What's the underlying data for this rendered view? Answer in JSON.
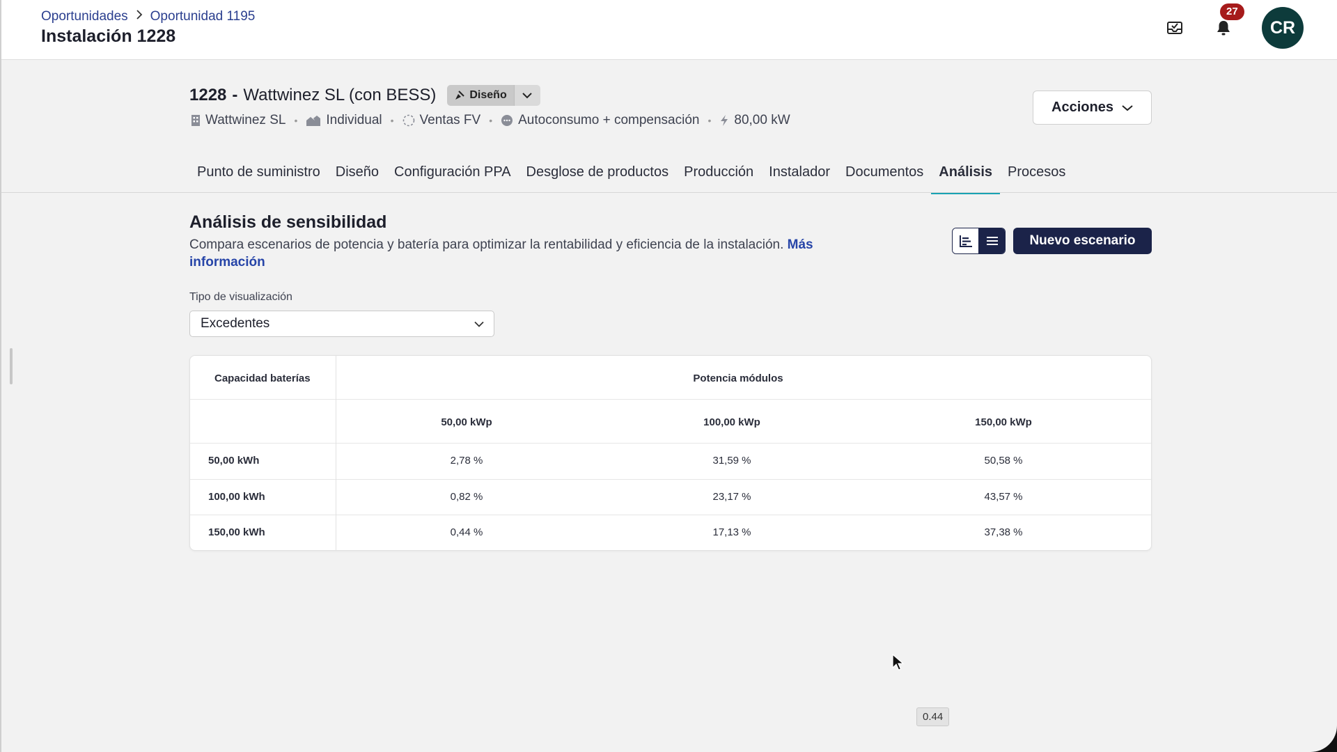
{
  "breadcrumb": {
    "items": [
      "Oportunidades",
      "Oportunidad 1195"
    ],
    "title": "Instalación 1228"
  },
  "notifications": {
    "count": "27"
  },
  "avatar": {
    "initials": "CR"
  },
  "installation": {
    "id": "1228",
    "separator": "-",
    "name": "Wattwinez SL (con BESS)",
    "state": "Diseño",
    "meta": [
      "Wattwinez SL",
      "Individual",
      "Ventas FV",
      "Autoconsumo + compensación",
      "80,00 kW"
    ]
  },
  "actions": {
    "label": "Acciones"
  },
  "tabs": [
    "Punto de suministro",
    "Diseño",
    "Configuración PPA",
    "Desglose de productos",
    "Producción",
    "Instalador",
    "Documentos",
    "Análisis",
    "Procesos"
  ],
  "active_tab": "Análisis",
  "section": {
    "title": "Análisis de sensibilidad",
    "description": "Compara escenarios de potencia y batería para optimizar la rentabilidad y eficiencia de la instalación.",
    "more_link": "Más información",
    "new_button": "Nuevo escenario"
  },
  "visualization": {
    "label": "Tipo de visualización",
    "value": "Excedentes"
  },
  "table": {
    "row_header": "Capacidad baterías",
    "col_group": "Potencia módulos",
    "columns": [
      "50,00 kWp",
      "100,00 kWp",
      "150,00 kWp"
    ],
    "rows": [
      {
        "label": "50,00 kWh",
        "values": [
          "2,78 %",
          "31,59 %",
          "50,58 %"
        ]
      },
      {
        "label": "100,00 kWh",
        "values": [
          "0,82 %",
          "23,17 %",
          "43,57 %"
        ]
      },
      {
        "label": "150,00 kWh",
        "values": [
          "0,44 %",
          "17,13 %",
          "37,38 %"
        ]
      }
    ]
  },
  "tooltip": {
    "value": "0.44"
  },
  "colors": {
    "primary": "#1b2349",
    "accent_tab": "#1aa3b3",
    "badge": "#a61b1b",
    "avatar": "#0d3b3b",
    "link": "#2745a8"
  }
}
